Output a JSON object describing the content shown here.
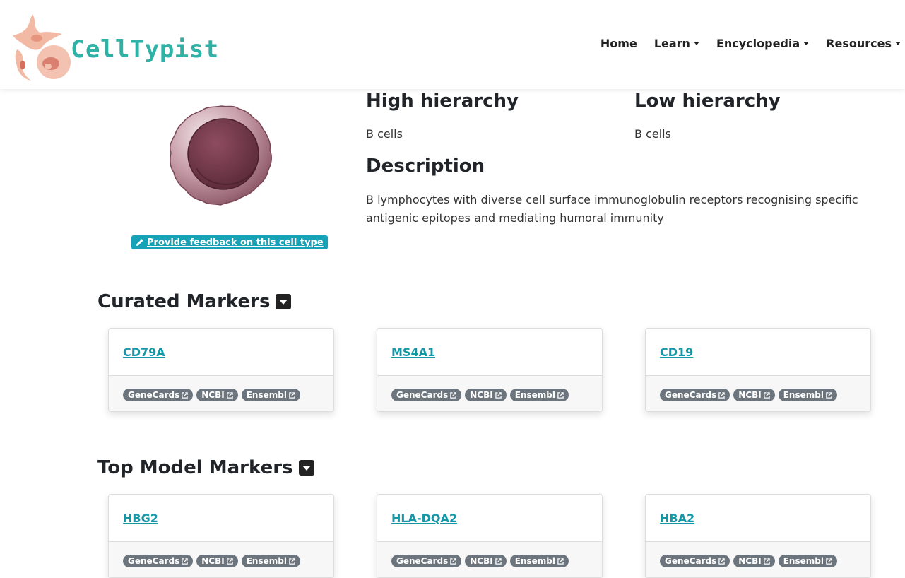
{
  "brand": {
    "name": "CellTypist"
  },
  "nav": [
    {
      "label": "Home",
      "dropdown": false
    },
    {
      "label": "Learn",
      "dropdown": true
    },
    {
      "label": "Encyclopedia",
      "dropdown": true
    },
    {
      "label": "Resources",
      "dropdown": true
    }
  ],
  "hero": {
    "feedback_label": "Provide feedback on this cell type",
    "high_title": "High hierarchy",
    "high_value": "B cells",
    "low_title": "Low hierarchy",
    "low_value": "B cells",
    "desc_title": "Description",
    "desc_text": "B lymphocytes with diverse cell surface immunoglobulin receptors recognising specific antigenic epitopes and mediating humoral immunity"
  },
  "curated": {
    "title": "Curated Markers",
    "genes": [
      "CD79A",
      "MS4A1",
      "CD19"
    ]
  },
  "model": {
    "title": "Top Model Markers",
    "genes": [
      "HBG2",
      "HLA-DQA2",
      "HBA2"
    ]
  },
  "badges": [
    "GeneCards",
    "NCBI",
    "Ensembl"
  ],
  "colors": {
    "accent": "#17a2b8",
    "link": "#1597a8",
    "badge": "#6c757d",
    "brand": "#2fb1a6"
  }
}
